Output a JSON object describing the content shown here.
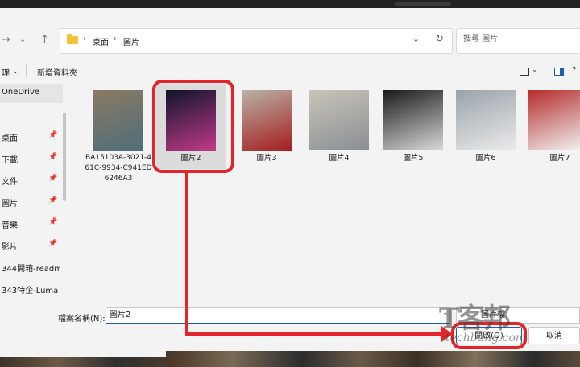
{
  "address": {
    "crumbs": [
      "桌面",
      "圖片"
    ],
    "search_placeholder": "搜尋 圖片"
  },
  "toolbar": {
    "organize": "理",
    "new_folder": "新增資料夾"
  },
  "sidebar": {
    "items": [
      {
        "label": "OneDrive",
        "pinned": false
      },
      {
        "label": "桌面",
        "pinned": true
      },
      {
        "label": "下載",
        "pinned": true
      },
      {
        "label": "文件",
        "pinned": true
      },
      {
        "label": "圖片",
        "pinned": true
      },
      {
        "label": "音樂",
        "pinned": true
      },
      {
        "label": "影片",
        "pinned": true
      },
      {
        "label": "344開箱-readm",
        "pinned": false
      },
      {
        "label": "343特企-Luma",
        "pinned": false
      }
    ]
  },
  "files": [
    {
      "name": "BA15103A-3021-461C-9934-C941ED6246A3",
      "selected": false,
      "colors": [
        "#8a7a63",
        "#4f6d7a"
      ]
    },
    {
      "name": "圖片2",
      "selected": true,
      "colors": [
        "#10152a",
        "#c23a8a"
      ]
    },
    {
      "name": "圖片3",
      "selected": false,
      "colors": [
        "#b9b2a6",
        "#a31d1d"
      ]
    },
    {
      "name": "圖片4",
      "selected": false,
      "colors": [
        "#c9c4b8",
        "#8a8f95"
      ]
    },
    {
      "name": "圖片5",
      "selected": false,
      "colors": [
        "#1a1a1a",
        "#d8d8d8"
      ]
    },
    {
      "name": "圖片6",
      "selected": false,
      "colors": [
        "#9aa3aa",
        "#eaeaea"
      ]
    },
    {
      "name": "圖片7",
      "selected": false,
      "colors": [
        "#b52b2b",
        "#f2f2f2"
      ]
    }
  ],
  "footer": {
    "filename_label": "檔案名稱(N):",
    "filename_value": "圖片2",
    "filter": "圖片檔",
    "open": "開啟(O)",
    "cancel": "取消"
  },
  "watermark": {
    "big": "T客邦",
    "small": "techbang.com"
  },
  "colors": {
    "highlight": "#e3242b",
    "accent": "#1a5fb4"
  }
}
